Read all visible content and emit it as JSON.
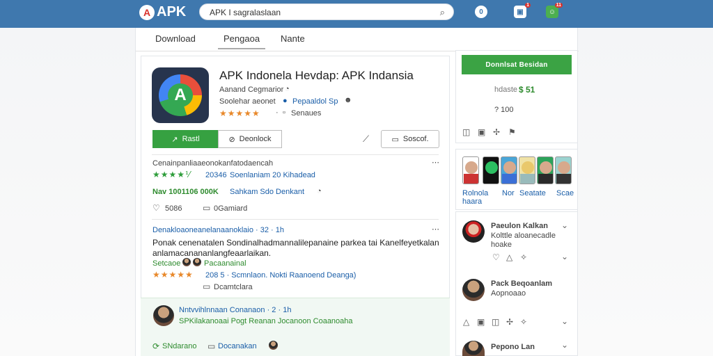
{
  "header": {
    "logo": "APK",
    "logo_badge": "A",
    "search_value": "APK I sagralaslaan",
    "icons": [
      "o-icon",
      "notification-icon",
      "user-icon"
    ],
    "notif_a": "1",
    "notif_b": "11",
    "badge_o": "0"
  },
  "tabs": [
    "Download",
    "Pengaoa",
    "Nante"
  ],
  "app": {
    "title": "APK Indonela Hevdap: APK Indansia",
    "developer": "Aanand Cegmarior",
    "subline": "Soolehar aeonet",
    "badge": "Pepaaldol Sp",
    "rating_stars": "★★★★★",
    "reviews": "Senaues",
    "install_label": "Rastl",
    "download_label": "Deonlock",
    "share_label": "Soscof."
  },
  "stats": {
    "heading": "Cenainpanliaaeonokanfatodaencah",
    "row1_rating": "20346",
    "row1_text": "Soenlaniam 20 Kihadead",
    "row2_text": "Nav 1001106 000K",
    "row2_link": "Sahkam Sdo Denkant",
    "likes": "5086",
    "comments": "0Gamiard"
  },
  "review1": {
    "heading": "Denakloaoneanelanaanoklaio · 32 · 1h",
    "body1": "Ponak cenenatalen Sondinalhadmannalilepanaine parkea tai Kanelfeyetkalan",
    "body2": "anlamacanananlangfeaarlaikan.",
    "tag1": "Setcaoe",
    "tag2": "Pacaanainal",
    "meta": "208 5 · Scmnlaon. Nokti Raanoend Deanga)",
    "comments": "Dcamtclara"
  },
  "review2": {
    "heading": "Nntvvihlnnaan Conanaon · 2 · 1h",
    "sub": "SPKilakanoaai Pogt Reanan Jocanoon Coaanoaha",
    "action1": "SNdarano",
    "action2": "Docanakan"
  },
  "right": {
    "cta": "Donnlsat Besidan",
    "price_label": "hdaste",
    "price": "$ 51",
    "count": "? 100",
    "screens": [
      "Rolnola haara",
      "Nor",
      "Seatate",
      "Scae"
    ]
  },
  "comments": [
    {
      "name": "Paeulon Kalkan",
      "line1": "Kolttle aloanecadle",
      "line2": "hoake"
    },
    {
      "name": "Pack Beqoanlam",
      "line1": "Aopnoaao",
      "line2": ""
    },
    {
      "name": "Pepono Lan",
      "line1": "",
      "line2": ""
    }
  ]
}
